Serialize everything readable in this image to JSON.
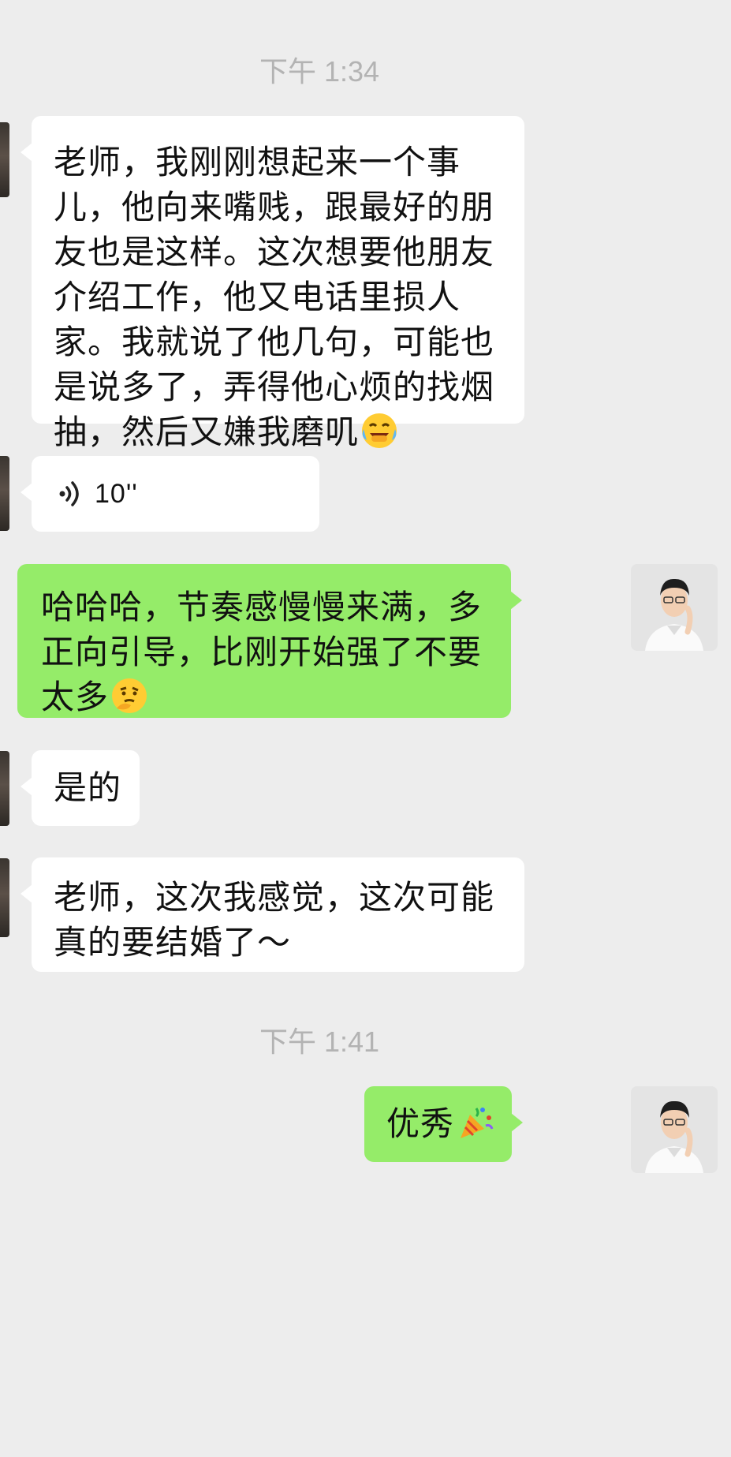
{
  "timestamps": [
    "下午 1:34",
    "下午 1:41"
  ],
  "messages": [
    {
      "side": "in",
      "type": "text",
      "text": "老师，我刚刚想起来一个事儿，他向来嘴贱，跟最好的朋友也是这样。这次想要他朋友介绍工作，他又电话里损人家。我就说了他几句，可能也是说多了，弄得他心烦的找烟抽，然后又嫌我磨叽",
      "emoji": "laughing-crying-emoji"
    },
    {
      "side": "in",
      "type": "voice",
      "duration": "10''",
      "icon": "voice-wave-icon"
    },
    {
      "side": "out",
      "type": "text",
      "text": "哈哈哈，节奏感慢慢来满，多正向引导，比刚开始强了不要太多",
      "emoji": "thinking-face-emoji"
    },
    {
      "side": "in",
      "type": "text",
      "text": "是的"
    },
    {
      "side": "in",
      "type": "text",
      "text": "老师，这次我感觉，这次可能真的要结婚了～"
    },
    {
      "side": "out",
      "type": "text",
      "text": "优秀",
      "emoji": "party-popper-emoji"
    }
  ],
  "colors": {
    "background": "#ededed",
    "incoming_bubble": "#ffffff",
    "outgoing_bubble": "#95ec69",
    "timestamp": "#b3b3b3"
  }
}
